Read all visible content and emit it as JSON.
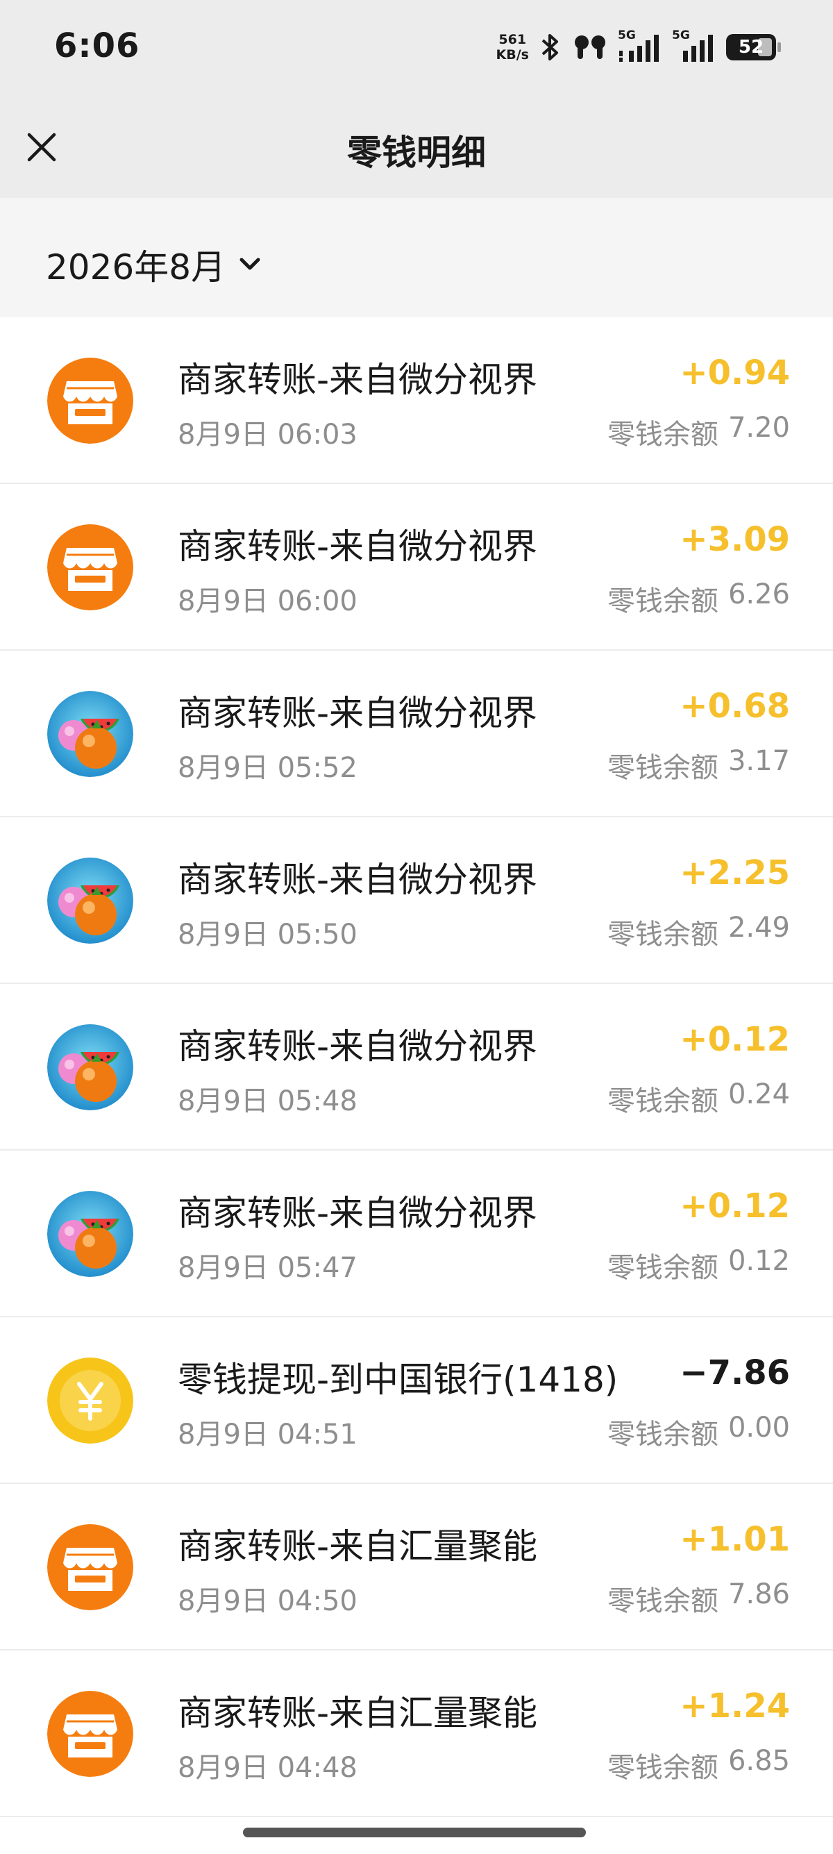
{
  "status_bar": {
    "time": "6:06",
    "net_speed_value": "561",
    "net_speed_unit": "KB/s",
    "signal_label_1": "5G",
    "signal_label_2": "5G",
    "battery_level": "52"
  },
  "header": {
    "title": "零钱明细",
    "close_icon": "close-icon"
  },
  "filter": {
    "month": "2026年8月",
    "dropdown_icon": "chevron-down-icon"
  },
  "colors": {
    "income": "#f6c02d",
    "expense": "#1a1a1a",
    "store_orange": "#f57d0f",
    "coin_yellow": "#f7c51a"
  },
  "transactions": [
    {
      "icon": "store-icon",
      "title": "商家转账-来自微分视界",
      "time": "8月9日 06:03",
      "amount": "+0.94",
      "balance_label": "零钱余额",
      "balance": "7.20"
    },
    {
      "icon": "store-icon",
      "title": "商家转账-来自微分视界",
      "time": "8月9日 06:00",
      "amount": "+3.09",
      "balance_label": "零钱余额",
      "balance": "6.26"
    },
    {
      "icon": "fruit-icon",
      "title": "商家转账-来自微分视界",
      "time": "8月9日 05:52",
      "amount": "+0.68",
      "balance_label": "零钱余额",
      "balance": "3.17"
    },
    {
      "icon": "fruit-icon",
      "title": "商家转账-来自微分视界",
      "time": "8月9日 05:50",
      "amount": "+2.25",
      "balance_label": "零钱余额",
      "balance": "2.49"
    },
    {
      "icon": "fruit-icon",
      "title": "商家转账-来自微分视界",
      "time": "8月9日 05:48",
      "amount": "+0.12",
      "balance_label": "零钱余额",
      "balance": "0.24"
    },
    {
      "icon": "fruit-icon",
      "title": "商家转账-来自微分视界",
      "time": "8月9日 05:47",
      "amount": "+0.12",
      "balance_label": "零钱余额",
      "balance": "0.12"
    },
    {
      "icon": "yuan-coin-icon",
      "title": "零钱提现-到中国银行(1418)",
      "time": "8月9日 04:51",
      "amount": "−7.86",
      "balance_label": "零钱余额",
      "balance": "0.00"
    },
    {
      "icon": "store-icon",
      "title": "商家转账-来自汇量聚能",
      "time": "8月9日 04:50",
      "amount": "+1.01",
      "balance_label": "零钱余额",
      "balance": "7.86"
    },
    {
      "icon": "store-icon",
      "title": "商家转账-来自汇量聚能",
      "time": "8月9日 04:48",
      "amount": "+1.24",
      "balance_label": "零钱余额",
      "balance": "6.85"
    }
  ]
}
